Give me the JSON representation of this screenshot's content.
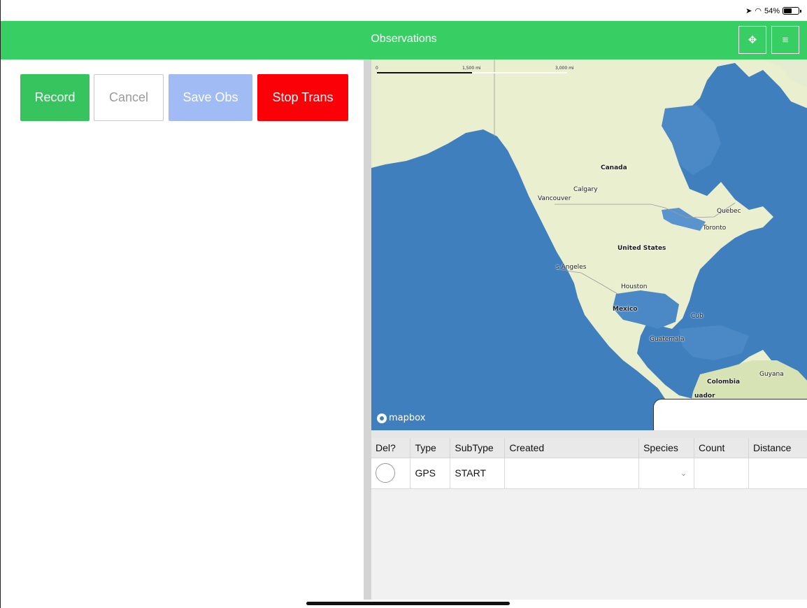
{
  "status_bar": {
    "battery_text": "54%",
    "battery_level": 0.54
  },
  "header": {
    "title": "Observations",
    "move_icon_glyph": "✥",
    "menu_icon_glyph": "≡"
  },
  "toolbar": {
    "record_label": "Record",
    "cancel_label": "Cancel",
    "save_label": "Save Obs",
    "stop_label": "Stop Trans"
  },
  "map": {
    "scale_labels": [
      "0",
      "1,500 mi",
      "3,000 mi"
    ],
    "labels": {
      "canada": "Canada",
      "calgary": "Calgary",
      "vancouver": "Vancouver",
      "quebec": "Quebec",
      "toronto": "Toronto",
      "united_states": "United States",
      "los_angeles": "s Angeles",
      "houston": "Houston",
      "mexico": "Mexico",
      "cuba": "Cub",
      "guatemala": "Guatemala",
      "guyana": "Guyana",
      "colombia": "Colombia",
      "ecuador": "uador"
    },
    "attribution": "mapbox"
  },
  "table": {
    "columns": [
      "Del?",
      "Type",
      "SubType",
      "Created",
      "Species",
      "Count",
      "Distance"
    ],
    "rows": [
      {
        "type": "GPS",
        "subtype": "START",
        "created": "",
        "species": "",
        "count": "",
        "distance": ""
      }
    ]
  },
  "colors": {
    "header_green": "#37cf63",
    "record_green": "#37c45e",
    "save_blue": "#a1bcf5",
    "stop_red": "#fb0007"
  }
}
